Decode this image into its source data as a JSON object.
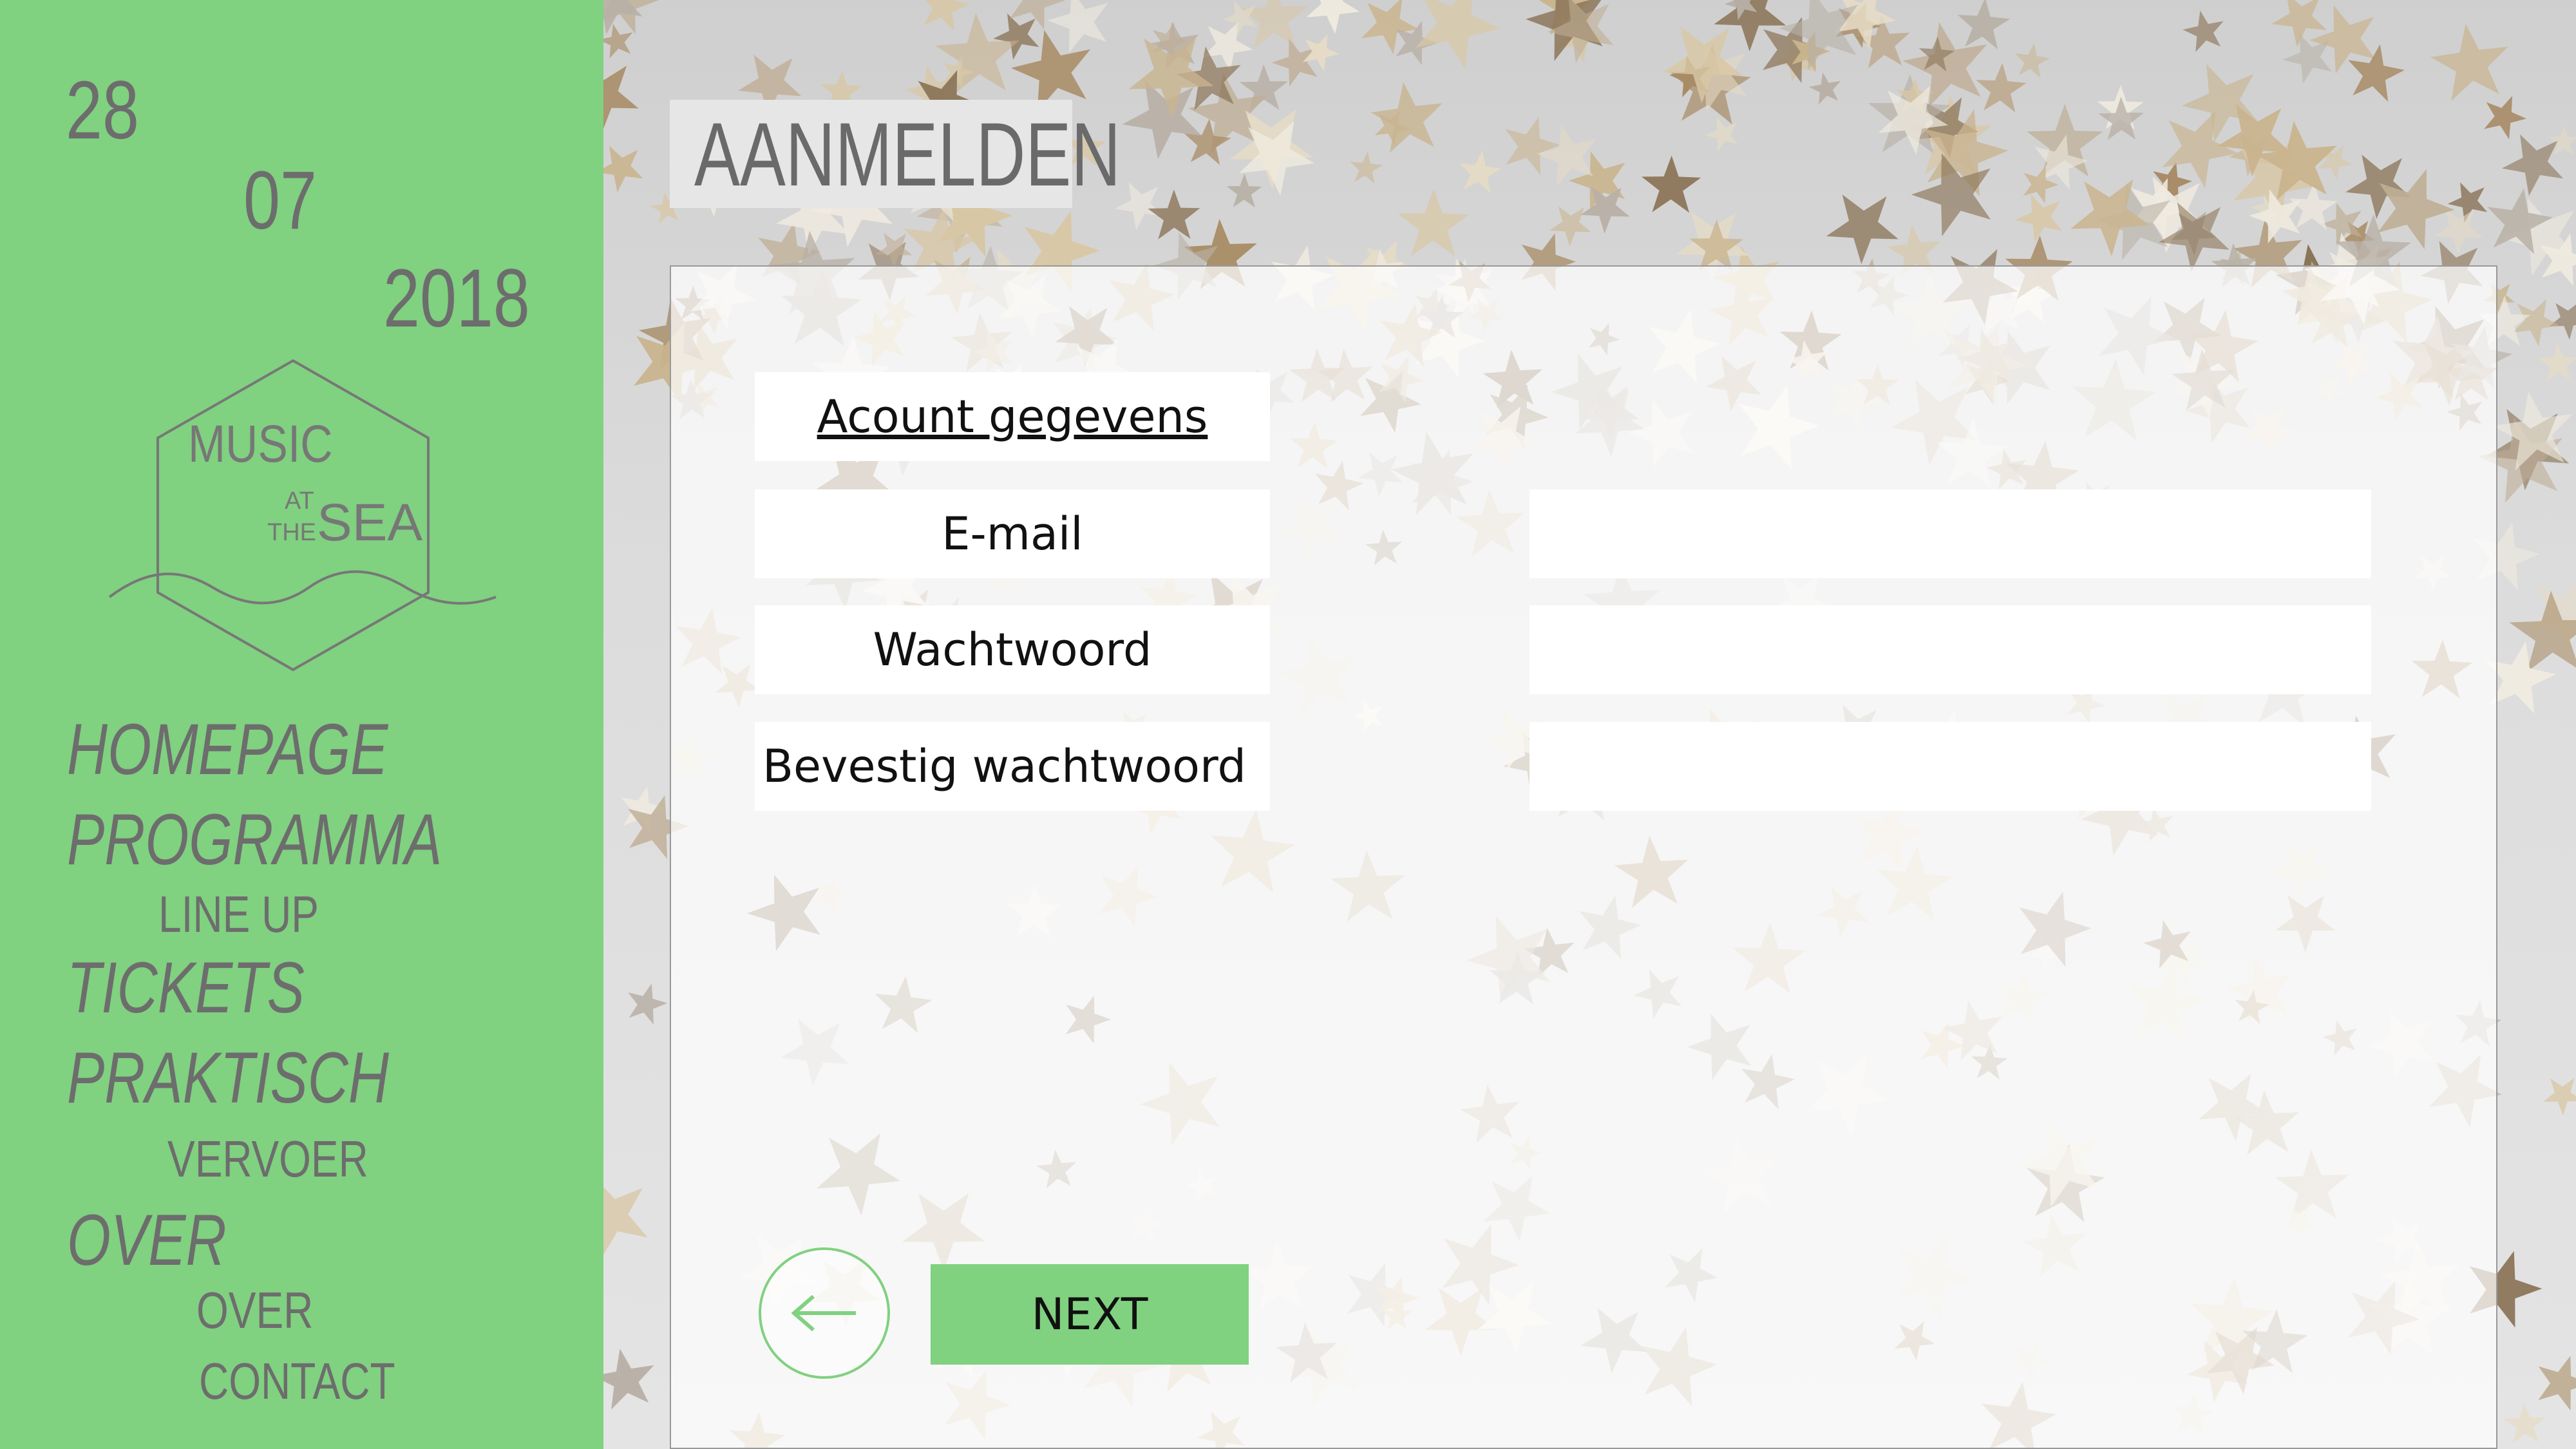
{
  "sidebar": {
    "date": {
      "day": "28",
      "month": "07",
      "year": "2018"
    },
    "logo": {
      "line1": "MUSIC",
      "at": "AT",
      "the": "THE",
      "line2": "SEA"
    },
    "nav": {
      "homepage": "HOMEPAGE",
      "programma": "PROGRAMMA",
      "lineup": "LINE UP",
      "tickets": "TICKETS",
      "praktisch": "PRAKTISCH",
      "vervoer": "VERVOER",
      "over": "OVER",
      "over_sub": "OVER",
      "contact": "CONTACT"
    }
  },
  "main": {
    "title": "AANMELDEN",
    "form": {
      "section_title": "Acount gegevens",
      "email_label": "E-mail",
      "email_value": "",
      "password_label": "Wachtwoord",
      "password_value": "",
      "confirm_label": "Bevestig wachtwoord",
      "confirm_value": ""
    },
    "back_icon": "arrow-left-icon",
    "next_label": "NEXT"
  },
  "colors": {
    "accent": "#80d180",
    "text_gray": "#6d6d6d",
    "panel_bg": "#ffffff"
  }
}
